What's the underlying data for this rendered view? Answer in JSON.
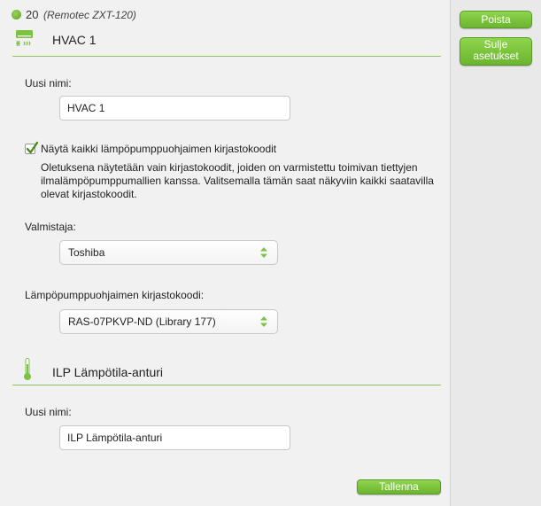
{
  "device": {
    "number": "20",
    "model": "(Remotec ZXT-120)"
  },
  "hvac": {
    "title": "HVAC 1",
    "name_label": "Uusi nimi:",
    "name_value": "HVAC 1",
    "show_all_label": "Näytä kaikki lämpöpumppuohjaimen kirjastokoodit",
    "show_all_checked": true,
    "description": "Oletuksena näytetään vain kirjastokoodit, joiden on varmistettu toimivan tiettyjen ilmalämpöpumppumallien kanssa. Valitsemalla tämän saat näkyviin kaikki saatavilla olevat kirjastokoodit.",
    "manufacturer_label": "Valmistaja:",
    "manufacturer_value": "Toshiba",
    "library_label": "Lämpöpumppuohjaimen kirjastokoodi:",
    "library_value": "RAS-07PKVP-ND (Library 177)"
  },
  "sensor": {
    "title": "ILP Lämpötila-anturi",
    "name_label": "Uusi nimi:",
    "name_value": "ILP Lämpötila-anturi"
  },
  "sidebar": {
    "delete_label": "Poista",
    "close_label": "Sulje asetukset"
  },
  "footer": {
    "save_label": "Tallenna"
  },
  "icons": {
    "hvac": "air-conditioner-icon",
    "sensor": "thermometer-icon",
    "status": "status-dot-icon"
  },
  "colors": {
    "accent": "#7dc242",
    "rule": "#8cc456",
    "accent_border": "#5c9a2c"
  }
}
